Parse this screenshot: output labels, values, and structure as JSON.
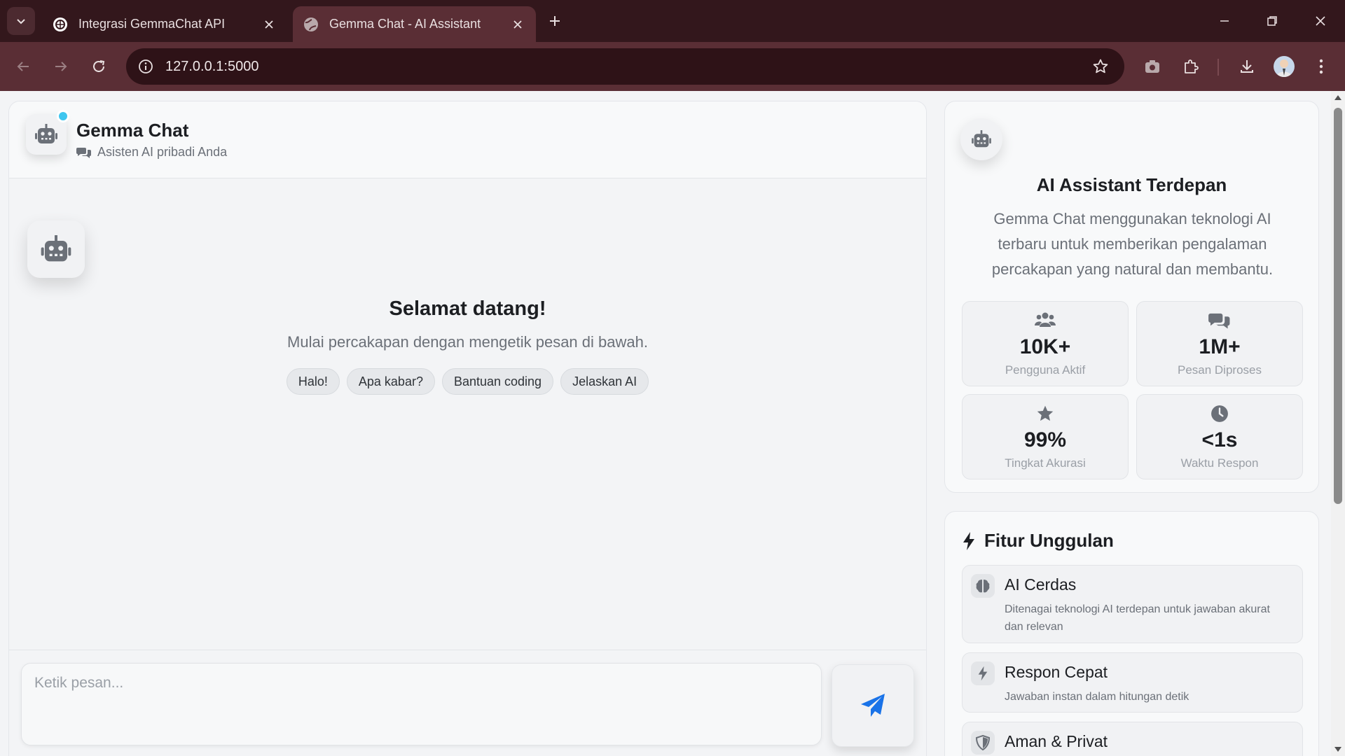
{
  "browser": {
    "tabs": [
      {
        "title": "Integrasi GemmaChat API",
        "active": false,
        "favicon": "openai-swirl-icon"
      },
      {
        "title": "Gemma Chat - AI Assistant",
        "active": true,
        "favicon": "globe-icon"
      }
    ],
    "url": "127.0.0.1:5000"
  },
  "chat": {
    "header": {
      "title": "Gemma Chat",
      "subtitle": "Asisten AI pribadi Anda",
      "online_color": "#3fc6ef"
    },
    "welcome": {
      "title": "Selamat datang!",
      "subtitle": "Mulai percakapan dengan mengetik pesan di bawah."
    },
    "suggestions": [
      "Halo!",
      "Apa kabar?",
      "Bantuan coding",
      "Jelaskan AI"
    ],
    "input_placeholder": "Ketik pesan...",
    "send_color": "#1a73e8"
  },
  "sidebar": {
    "info": {
      "title": "AI Assistant Terdepan",
      "description": "Gemma Chat menggunakan teknologi AI terbaru untuk memberikan pengalaman percakapan yang natural dan membantu."
    },
    "stats": [
      {
        "icon": "users-icon",
        "value": "10K+",
        "label": "Pengguna Aktif"
      },
      {
        "icon": "comments-icon",
        "value": "1M+",
        "label": "Pesan Diproses"
      },
      {
        "icon": "star-icon",
        "value": "99%",
        "label": "Tingkat Akurasi"
      },
      {
        "icon": "clock-icon",
        "value": "<1s",
        "label": "Waktu Respon"
      }
    ],
    "features": {
      "title": "Fitur Unggulan",
      "items": [
        {
          "icon": "brain-icon",
          "name": "AI Cerdas",
          "desc": "Ditenagai teknologi AI terdepan untuk jawaban akurat dan relevan"
        },
        {
          "icon": "bolt-icon",
          "name": "Respon Cepat",
          "desc": "Jawaban instan dalam hitungan detik"
        },
        {
          "icon": "shield-icon",
          "name": "Aman & Privat",
          "desc": ""
        }
      ]
    }
  }
}
